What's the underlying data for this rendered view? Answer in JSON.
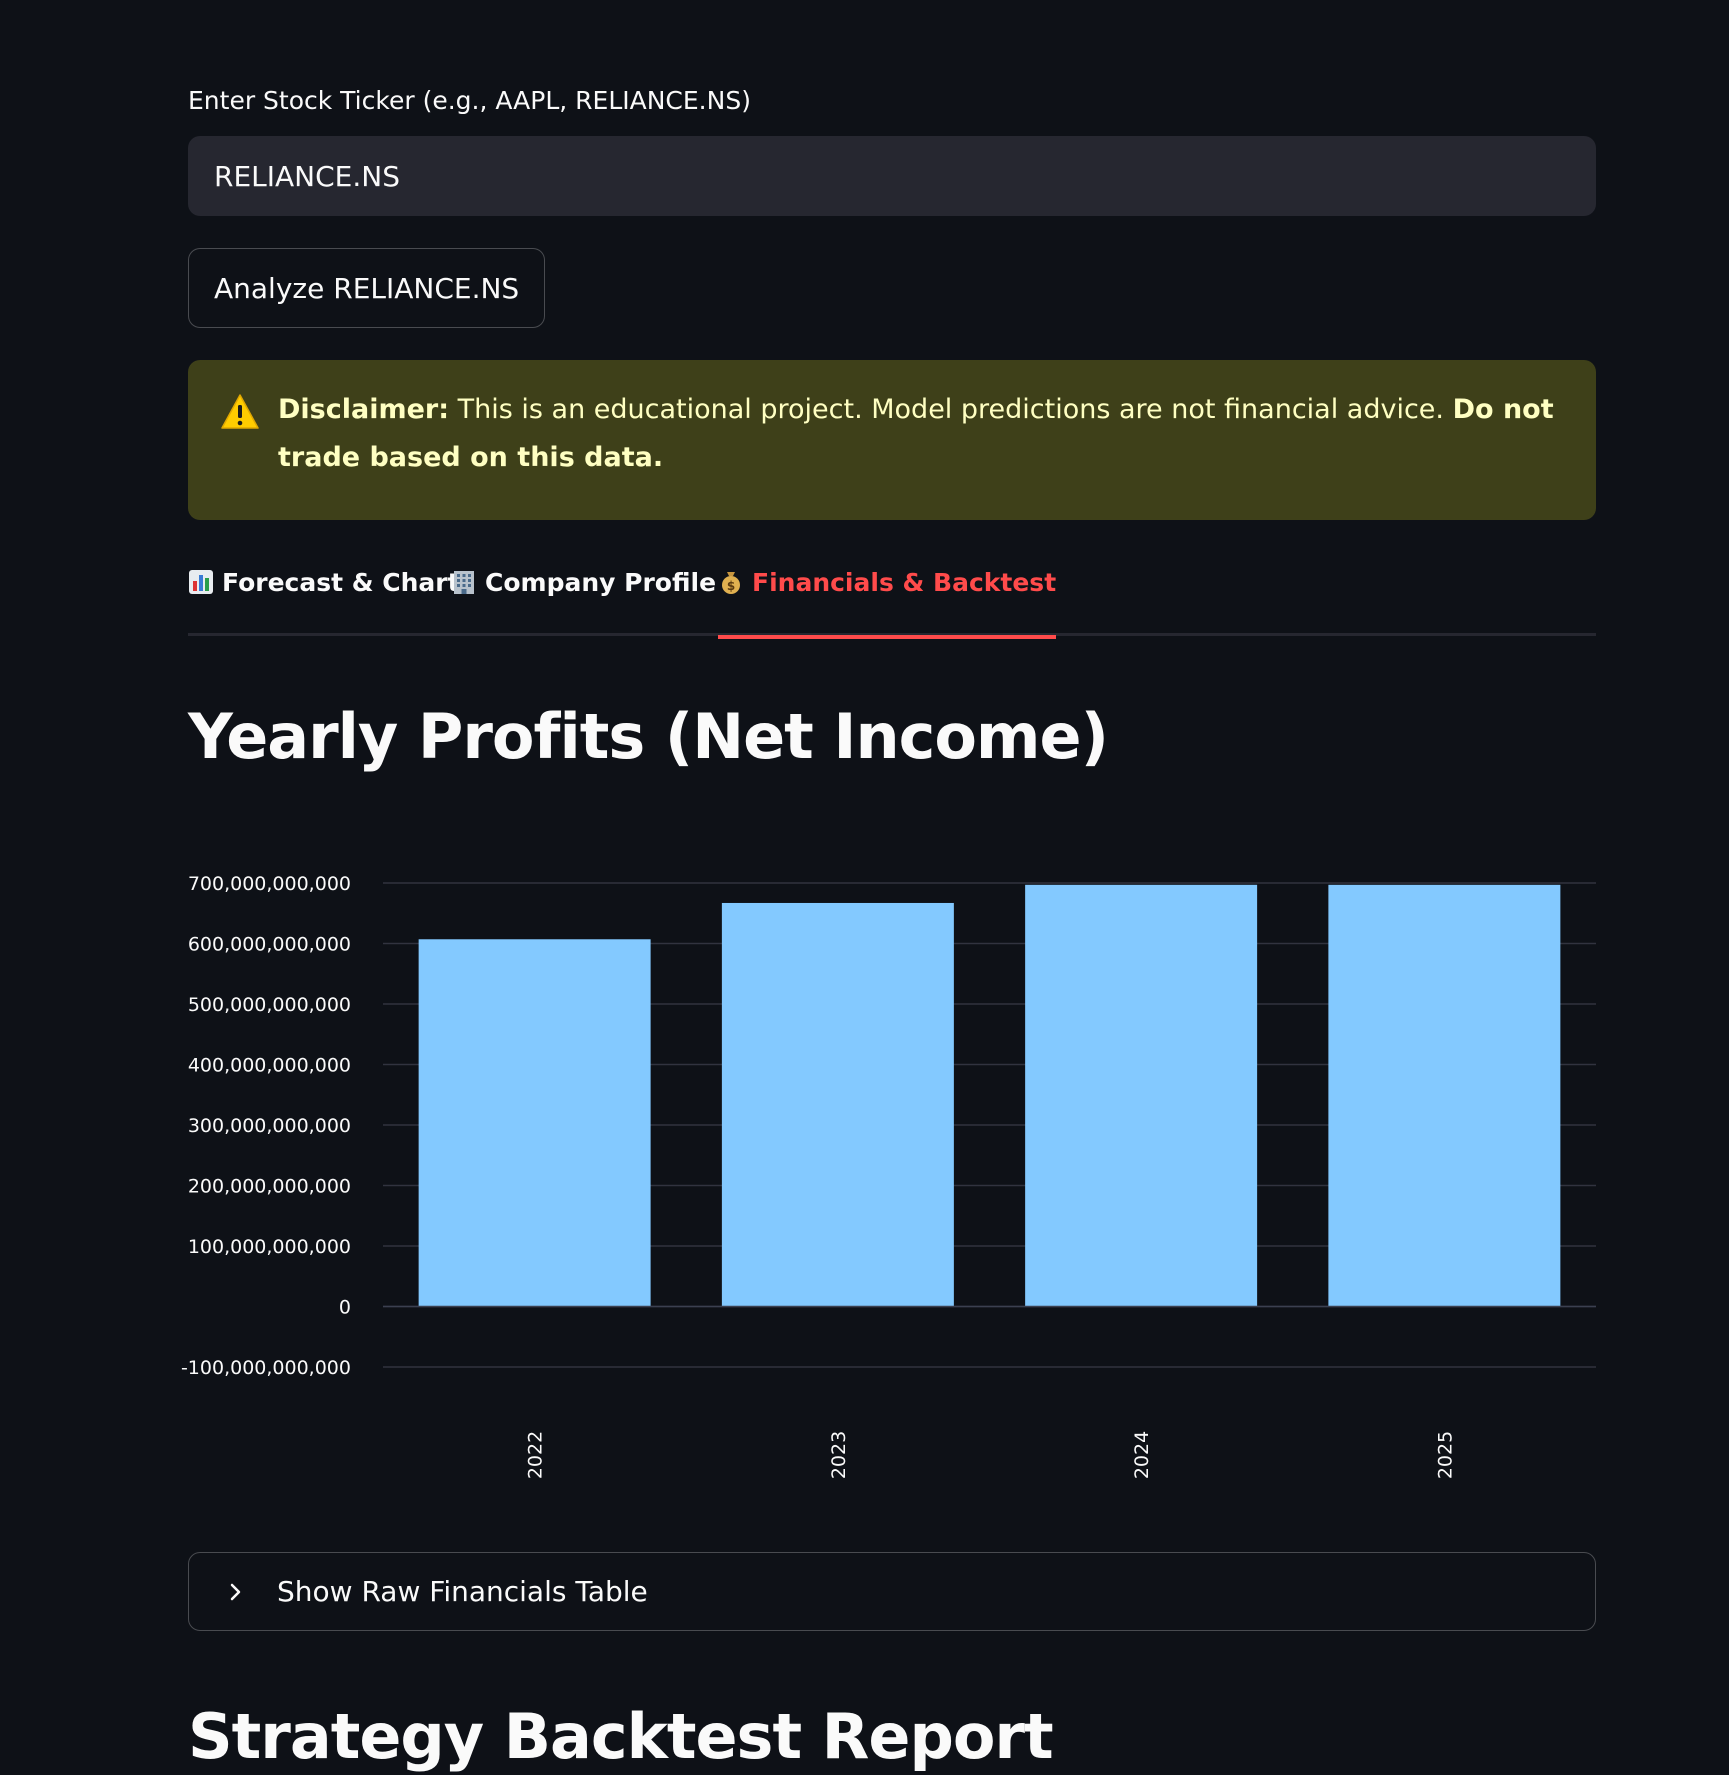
{
  "ticker_input": {
    "label": "Enter Stock Ticker (e.g., AAPL, RELIANCE.NS)",
    "value": "RELIANCE.NS"
  },
  "analyze_button": {
    "label": "Analyze RELIANCE.NS"
  },
  "disclaimer": {
    "icon": "warning-icon",
    "bold_prefix": "Disclaimer:",
    "text": " This is an educational project. Model predictions are not financial advice. ",
    "bold_suffix": "Do not trade based on this data.",
    "background": "#3e4019",
    "text_color": "#ffffc2"
  },
  "tabs": [
    {
      "icon": "bar-chart-icon",
      "label": "Forecast & Chart",
      "active": false
    },
    {
      "icon": "office-building-icon",
      "label": "Company Profile",
      "active": false
    },
    {
      "icon": "money-bag-icon",
      "label": "Financials & Backtest",
      "active": true
    }
  ],
  "accent_color": "#ff4b4b",
  "profits_section": {
    "title": "Yearly Profits (Net Income)"
  },
  "chart_data": {
    "type": "bar",
    "categories": [
      "2022",
      "2023",
      "2024",
      "2025"
    ],
    "values": [
      607000000000,
      667000000000,
      697000000000,
      697000000000
    ],
    "ylim": [
      -100000000000,
      700000000000
    ],
    "yticks": [
      -100000000000,
      0,
      100000000000,
      200000000000,
      300000000000,
      400000000000,
      500000000000,
      600000000000,
      700000000000
    ],
    "ytick_labels": [
      "-100,000,000,000",
      "0",
      "100,000,000,000",
      "200,000,000,000",
      "300,000,000,000",
      "400,000,000,000",
      "500,000,000,000",
      "600,000,000,000",
      "700,000,000,000"
    ],
    "bar_color": "#83c9ff",
    "grid": true,
    "xlabel": "",
    "ylabel": ""
  },
  "expander": {
    "label": "Show Raw Financials Table"
  },
  "backtest_section": {
    "title": "Strategy Backtest Report"
  }
}
